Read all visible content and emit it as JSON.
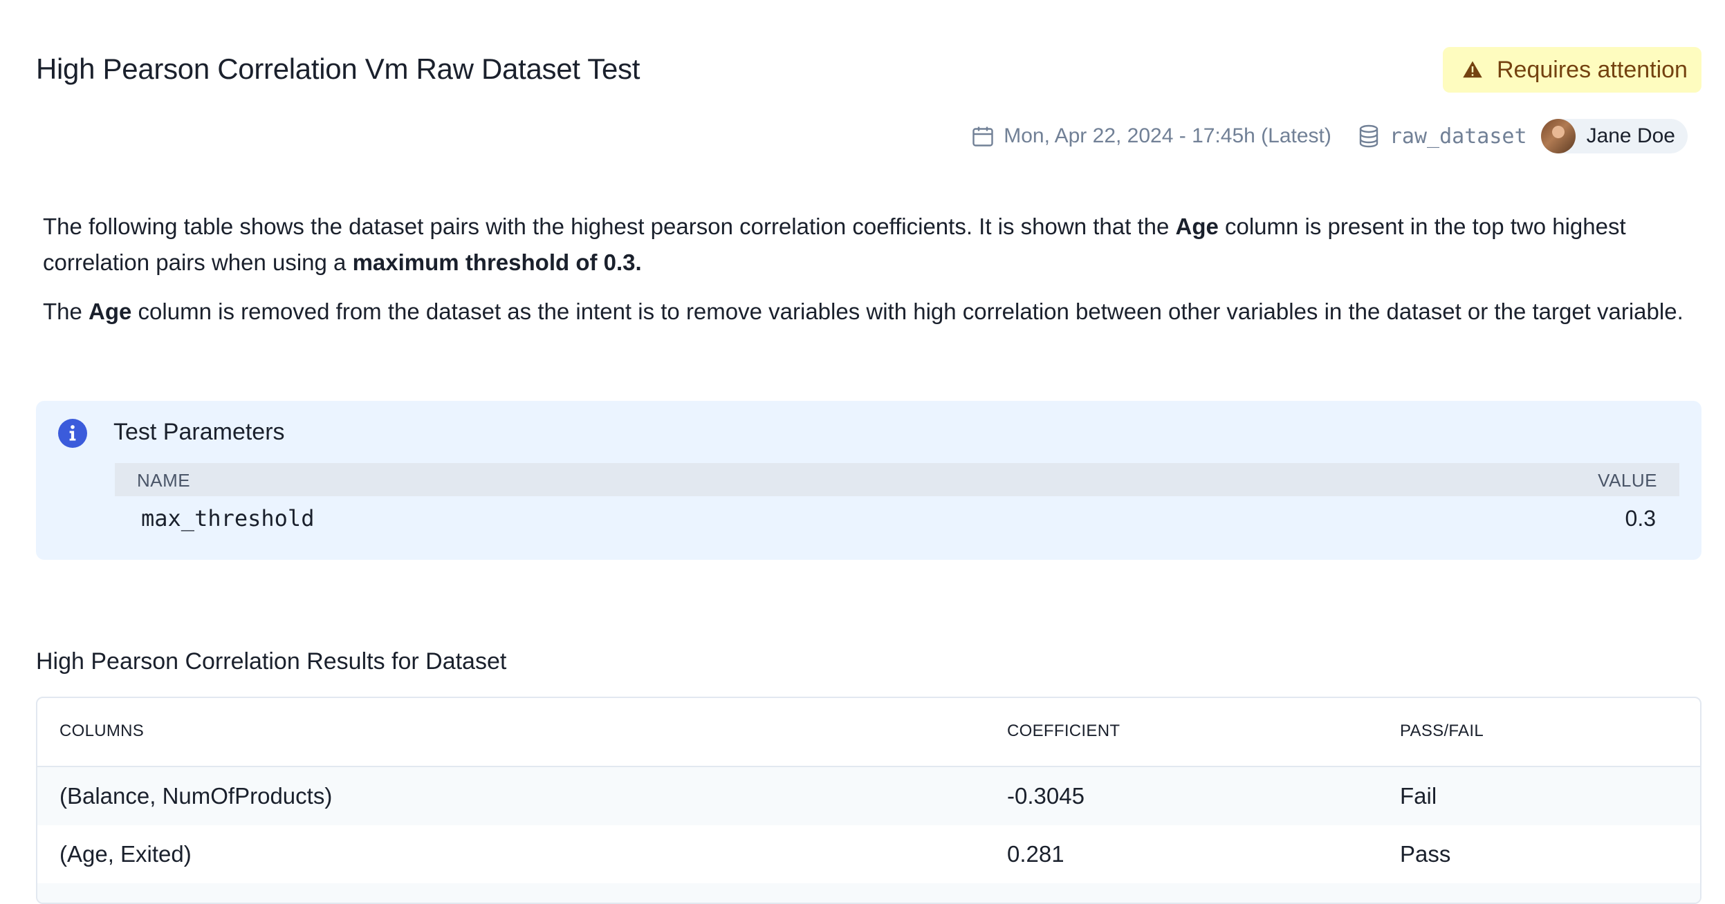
{
  "header": {
    "title": "High Pearson Correlation Vm Raw Dataset Test",
    "status": "Requires attention",
    "date": "Mon, Apr 22, 2024 - 17:45h (Latest)",
    "dataset": "raw_dataset",
    "user": "Jane Doe"
  },
  "description": {
    "p1_a": "The following table shows the dataset pairs with the highest pearson correlation coefficients. It is shown that the ",
    "p1_b": "Age",
    "p1_c": " column is present in the top two highest correlation pairs when using a ",
    "p1_d": "maximum threshold of 0.3.",
    "p2_a": "The ",
    "p2_b": "Age",
    "p2_c": " column is removed from the dataset as the intent is to remove variables with high correlation between other variables in the dataset or the target variable."
  },
  "parameters": {
    "title": "Test Parameters",
    "headers": {
      "name": "NAME",
      "value": "VALUE"
    },
    "rows": [
      {
        "name": "max_threshold",
        "value": "0.3"
      }
    ]
  },
  "results": {
    "title": "High Pearson Correlation Results for Dataset",
    "headers": {
      "columns": "COLUMNS",
      "coefficient": "COEFFICIENT",
      "pass_fail": "PASS/FAIL"
    },
    "rows": [
      {
        "columns": "(Balance, NumOfProducts)",
        "coefficient": "-0.3045",
        "pass_fail": "Fail"
      },
      {
        "columns": "(Age, Exited)",
        "coefficient": "0.281",
        "pass_fail": "Pass"
      }
    ]
  },
  "colors": {
    "badge_bg": "#fefcbf",
    "badge_text": "#744210",
    "panel_bg": "#ebf4ff",
    "info_icon": "#3b5bdb"
  },
  "icons": {
    "status": "warning-triangle-icon",
    "date": "calendar-icon",
    "dataset": "database-icon",
    "info": "info-circle-icon"
  }
}
